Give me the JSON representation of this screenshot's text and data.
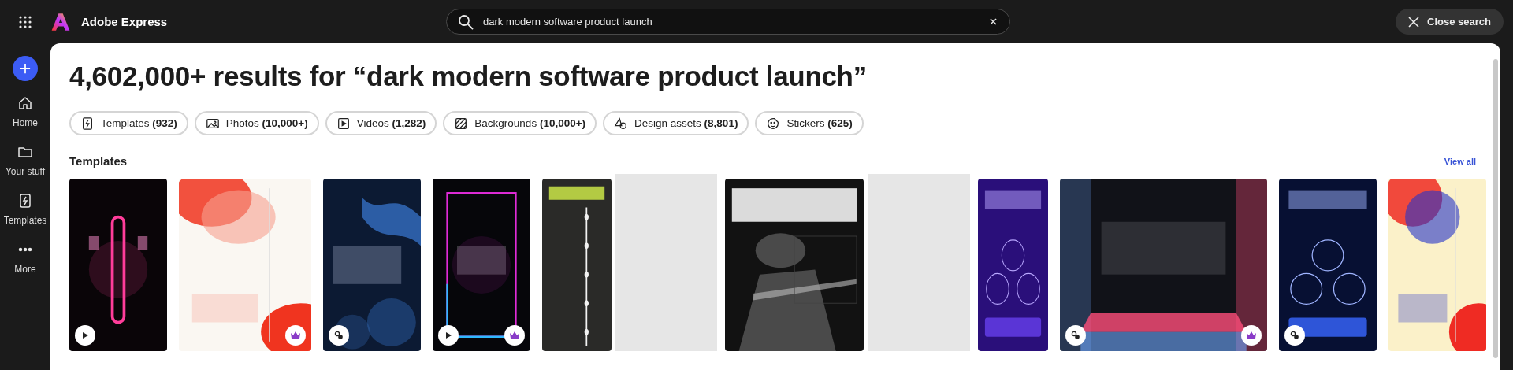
{
  "app": {
    "name": "Adobe Express"
  },
  "search": {
    "value": "dark modern software product launch",
    "close_label": "Close search"
  },
  "sidebar": {
    "items": [
      {
        "label": "Home"
      },
      {
        "label": "Your stuff"
      },
      {
        "label": "Templates"
      },
      {
        "label": "More"
      }
    ]
  },
  "heading": "4,602,000+ results for “dark modern software product launch”",
  "filters": [
    {
      "label": "Templates **(932)**"
    },
    {
      "label": "Photos **(10,000+)**"
    },
    {
      "label": "Videos **(1,282)**"
    },
    {
      "label": "Backgrounds **(10,000+)**"
    },
    {
      "label": "Design assets **(8,801)**"
    },
    {
      "label": "Stickers **(625)**"
    }
  ],
  "templates": {
    "title": "Templates",
    "view_all": "View all",
    "items": [
      {
        "kind": "video",
        "premium": false
      },
      {
        "kind": "picture",
        "premium": true
      },
      {
        "kind": "remix",
        "premium": false
      },
      {
        "kind": "video",
        "premium": true
      },
      {
        "kind": "picture",
        "premium": false
      },
      {
        "kind": "loading"
      },
      {
        "kind": "picture",
        "premium": false
      },
      {
        "kind": "loading"
      },
      {
        "kind": "picture",
        "premium": false
      },
      {
        "kind": "remix",
        "premium": true
      },
      {
        "kind": "remix",
        "premium": false
      },
      {
        "kind": "picture",
        "premium": false
      }
    ]
  }
}
